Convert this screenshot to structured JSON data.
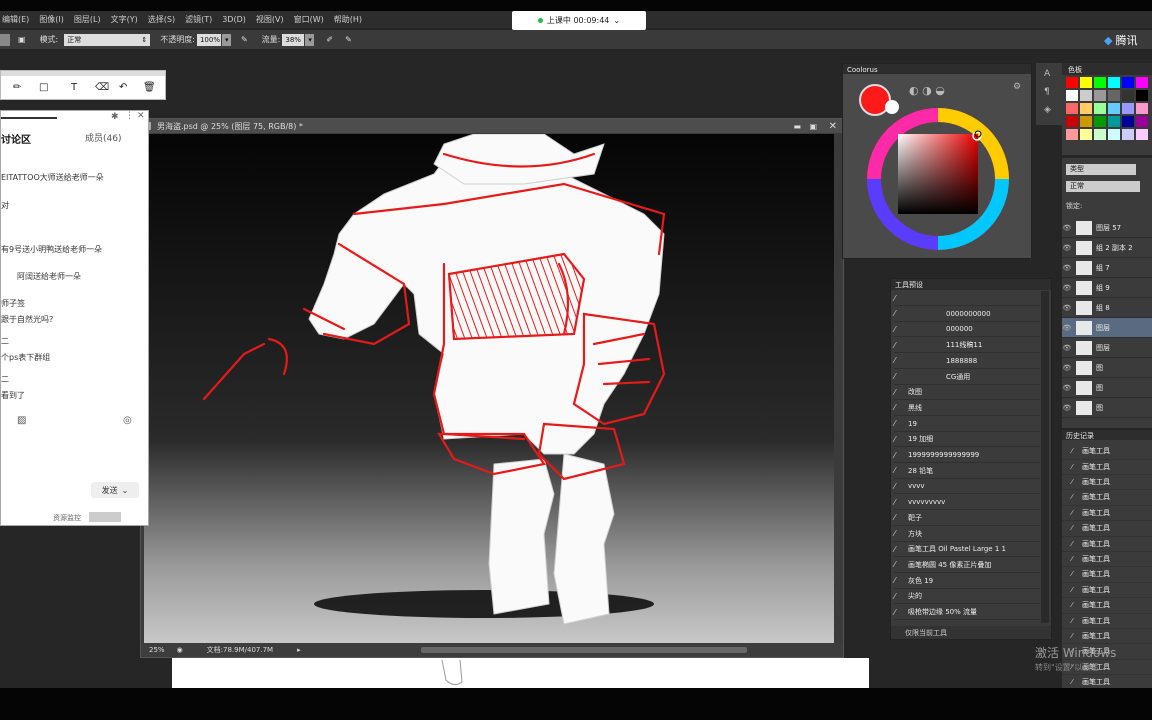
{
  "menu": [
    "编辑(E)",
    "图像(I)",
    "图层(L)",
    "文字(Y)",
    "选择(S)",
    "滤镜(T)",
    "3D(D)",
    "视图(V)",
    "窗口(W)",
    "帮助(H)"
  ],
  "live_badge": "上课中 00:09:44",
  "options": {
    "mode_label": "模式:",
    "mode_value": "正常",
    "opacity_label": "不透明度:",
    "opacity_value": "100%",
    "flow_label": "流量:",
    "flow_value": "38%"
  },
  "brand": "腾讯",
  "document": {
    "title": "男海盗.psd @ 25% (图层 75, RGB/8) *",
    "zoom": "25%",
    "doc_info": "文档:78.9M/407.7M"
  },
  "chat": {
    "title": "讨论区",
    "members": "成员(46)",
    "messages": [
      "EITATTOO大师送给老师一朵",
      "对",
      "有9号送小明鸭送给老师一朵",
      "阿阔送给老师一朵",
      "师子签",
      "跟于自然光吗?",
      "二",
      "个ps表下群组",
      "二",
      "看到了"
    ],
    "send": "发送",
    "resource": "资源监控"
  },
  "coolorus": {
    "title": "Coolorus"
  },
  "presets": {
    "title": "工具预设",
    "items": [
      "",
      "0000000000",
      "000000",
      "111线稿11",
      "1888888",
      "CG通用",
      "改图",
      "黑线",
      "19",
      "19 加细",
      "1999999999999999",
      "28 铅笔",
      "vvvv",
      "vvvvvvvvv",
      "靶子",
      "方块",
      "画笔工具 Oil Pastel Large 1 1",
      "画笔椭圆 45 像素正片叠加",
      "灰色 19",
      "尖的",
      "吸枪带边缘 50% 流量"
    ],
    "footer": "仅限当前工具"
  },
  "swatches": {
    "title": "色板",
    "colors": [
      "#ff0000",
      "#ffff00",
      "#00ff00",
      "#00ffff",
      "#0000ff",
      "#ff00ff",
      "#ffffff",
      "#cccccc",
      "#999999",
      "#666666",
      "#333333",
      "#000000",
      "#ff6666",
      "#ffcc66",
      "#99ff99",
      "#66ccff",
      "#9999ff",
      "#ff99cc",
      "#cc0000",
      "#cc9900",
      "#009900",
      "#009999",
      "#000099",
      "#990099",
      "#ff9999",
      "#ffff99",
      "#ccffcc",
      "#ccffff",
      "#ccccff",
      "#ffccff"
    ]
  },
  "layers": {
    "kind": "类型",
    "blend": "正常",
    "lock": "锁定:",
    "rows": [
      "图层 57",
      "组 2 副本 2",
      "组 7",
      "组 9",
      "组 8",
      "图层",
      "图层",
      "图",
      "图",
      "图"
    ]
  },
  "history": {
    "title": "历史记录",
    "items": [
      "画笔工具",
      "画笔工具",
      "画笔工具",
      "画笔工具",
      "画笔工具",
      "画笔工具",
      "画笔工具",
      "画笔工具",
      "画笔工具",
      "画笔工具",
      "画笔工具",
      "画笔工具",
      "画笔工具",
      "画笔工具",
      "画笔工具",
      "画笔工具"
    ]
  },
  "watermark": {
    "line1": "激活 Windows",
    "line2": "转到\"设置\"以激活"
  },
  "colors": {
    "accent": "#ff1a1a",
    "panel": "#3b3b3b",
    "canvas_bg": "#0d0d0d"
  }
}
